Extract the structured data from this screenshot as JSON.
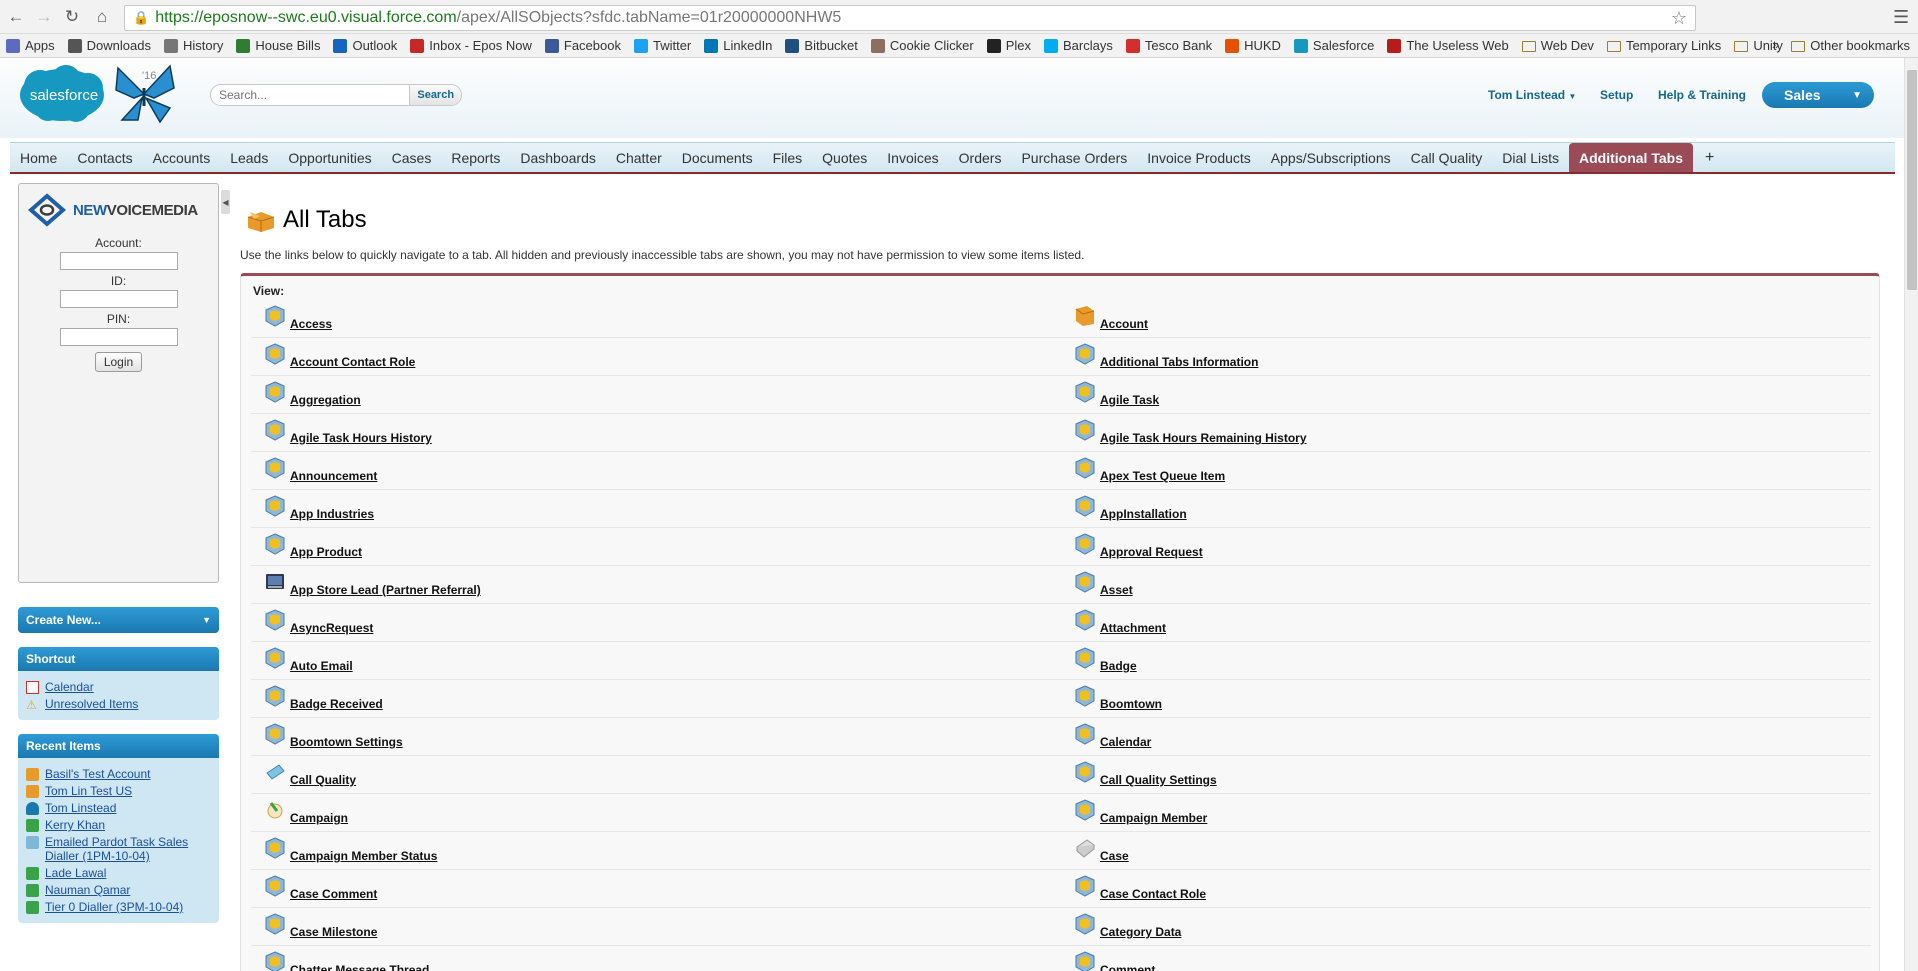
{
  "browser": {
    "url_domain": "https://eposnow--swc.eu0.visual.force.com",
    "url_path": "/apex/AllSObjects?sfdc.tabName=01r20000000NHW5",
    "bookmarks": [
      "Apps",
      "Downloads",
      "History",
      "House Bills",
      "Outlook",
      "Inbox - Epos Now",
      "Facebook",
      "Twitter",
      "LinkedIn",
      "Bitbucket",
      "Cookie Clicker",
      "Plex",
      "Barclays",
      "Tesco Bank",
      "HUKD",
      "Salesforce",
      "The Useless Web",
      "Web Dev",
      "Temporary Links",
      "Unity"
    ],
    "bookmark_overflow": "»",
    "other_bookmarks": "Other bookmarks"
  },
  "header": {
    "logo_text": "salesforce",
    "logo_badge": "'16",
    "search_placeholder": "Search...",
    "search_button": "Search",
    "user_name": "Tom Linstead",
    "setup": "Setup",
    "help": "Help & Training",
    "app_name": "Sales"
  },
  "tabs": [
    "Home",
    "Contacts",
    "Accounts",
    "Leads",
    "Opportunities",
    "Cases",
    "Reports",
    "Dashboards",
    "Chatter",
    "Documents",
    "Files",
    "Quotes",
    "Invoices",
    "Orders",
    "Purchase Orders",
    "Invoice Products",
    "Apps/Subscriptions",
    "Call Quality",
    "Dial Lists",
    "Additional Tabs"
  ],
  "active_tab": "Additional Tabs",
  "plus_tab": "+",
  "sidebar": {
    "nvm_logo_a": "NEW",
    "nvm_logo_b": "VOICEMEDIA",
    "account_label": "Account:",
    "id_label": "ID:",
    "pin_label": "PIN:",
    "login_button": "Login",
    "create_new": "Create New...",
    "shortcut_title": "Shortcut",
    "shortcuts": [
      "Calendar",
      "Unresolved Items"
    ],
    "recent_title": "Recent Items",
    "recent_items": [
      "Basil's Test Account",
      "Tom Lin Test US",
      "Tom Linstead",
      "Kerry Khan",
      "Emailed Pardot Task Sales Dialler (1PM-10-04)",
      "Lade Lawal",
      "Nauman Qamar",
      "Tier 0 Dialler (3PM-10-04)"
    ]
  },
  "page": {
    "title": "All Tabs",
    "description": "Use the links below to quickly navigate to a tab. All hidden and previously inaccessible tabs are shown, you may not have permission to view some items listed.",
    "view_label": "View:"
  },
  "all_tabs": [
    [
      "Access",
      "Account"
    ],
    [
      "Account Contact Role",
      "Additional Tabs Information"
    ],
    [
      "Aggregation",
      "Agile Task"
    ],
    [
      "Agile Task Hours History",
      "Agile Task Hours Remaining History"
    ],
    [
      "Announcement",
      "Apex Test Queue Item"
    ],
    [
      "App Industries",
      "AppInstallation"
    ],
    [
      "App Product",
      "Approval Request"
    ],
    [
      "App Store Lead (Partner Referral)",
      "Asset"
    ],
    [
      "AsyncRequest",
      "Attachment"
    ],
    [
      "Auto Email",
      "Badge"
    ],
    [
      "Badge Received",
      "Boomtown"
    ],
    [
      "Boomtown Settings",
      "Calendar"
    ],
    [
      "Call Quality",
      "Call Quality Settings"
    ],
    [
      "Campaign",
      "Campaign Member"
    ],
    [
      "Campaign Member Status",
      "Case"
    ],
    [
      "Case Comment",
      "Case Contact Role"
    ],
    [
      "Case Milestone",
      "Category Data"
    ],
    [
      "Chatter Message Thread",
      "Comment"
    ]
  ],
  "colors": {
    "brand_blue": "#1a78b0",
    "active_tab": "#9b4b55",
    "link": "#1a4fa0"
  }
}
